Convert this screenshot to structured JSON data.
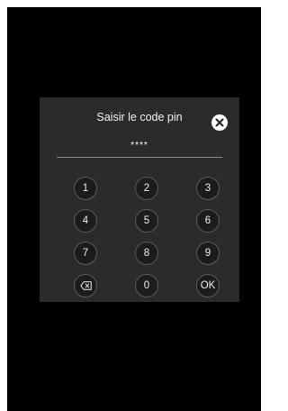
{
  "dialog": {
    "title": "Saisir le code pin",
    "pin_value": "****"
  },
  "keypad": {
    "k1": "1",
    "k2": "2",
    "k3": "3",
    "k4": "4",
    "k5": "5",
    "k6": "6",
    "k7": "7",
    "k8": "8",
    "k9": "9",
    "k0": "0",
    "ok": "OK",
    "backspace_icon": "backspace-icon"
  },
  "close_icon": "close-icon",
  "colors": {
    "screen_bg": "#000000",
    "dialog_bg": "#2b2b2b",
    "key_bg": "#1c1c1c",
    "key_border": "#5a5a5a",
    "text": "#eeeeee"
  }
}
